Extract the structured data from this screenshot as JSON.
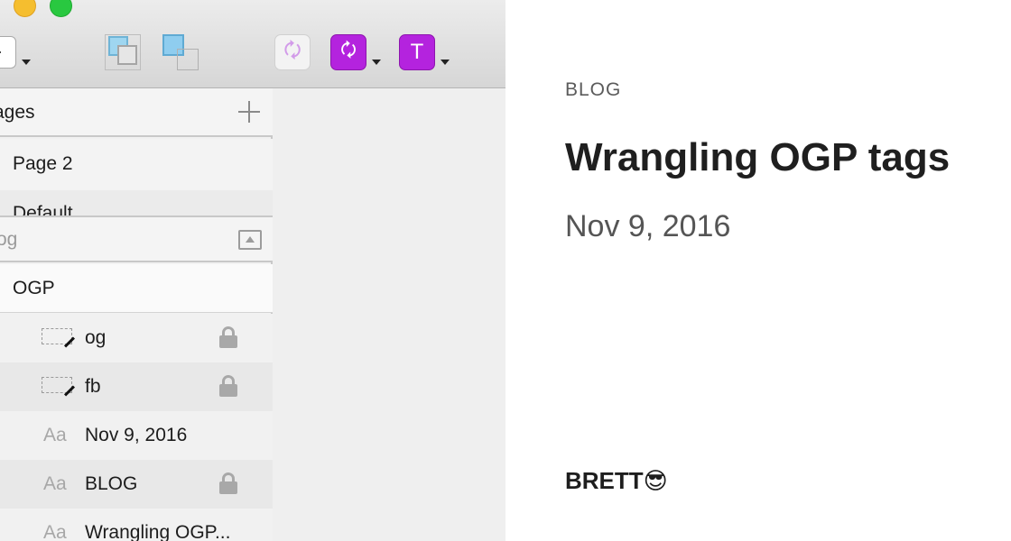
{
  "toolbar": {
    "buttons": {
      "insert": "insert-icon",
      "union": "union-icon",
      "subtract": "subtract-icon",
      "sync_disabled": "sync-icon",
      "sync_glyph": "🗘",
      "symbol": "sync-icon",
      "symbol_glyph": "🗘",
      "text_style": "text-style-icon",
      "text_glyph": "T"
    },
    "accent_color": "#b423de"
  },
  "pages_panel": {
    "header": "ages",
    "pages": [
      {
        "label": "Page 2"
      },
      {
        "label": "Default"
      }
    ]
  },
  "layers_panel": {
    "header": "og",
    "artboard": "OGP",
    "layers": [
      {
        "label": "og",
        "kind": "slice",
        "locked": true
      },
      {
        "label": "fb",
        "kind": "slice",
        "locked": true
      },
      {
        "label": "Nov 9, 2016",
        "kind": "text",
        "locked": false
      },
      {
        "label": "BLOG",
        "kind": "text",
        "locked": true
      },
      {
        "label": "Wrangling OGP...",
        "kind": "text",
        "locked": false
      }
    ],
    "text_icon_label": "Aa"
  },
  "preview": {
    "kicker": "BLOG",
    "title": "Wrangling OGP tags",
    "date": "Nov 9, 2016",
    "author": "BRETT😎"
  }
}
